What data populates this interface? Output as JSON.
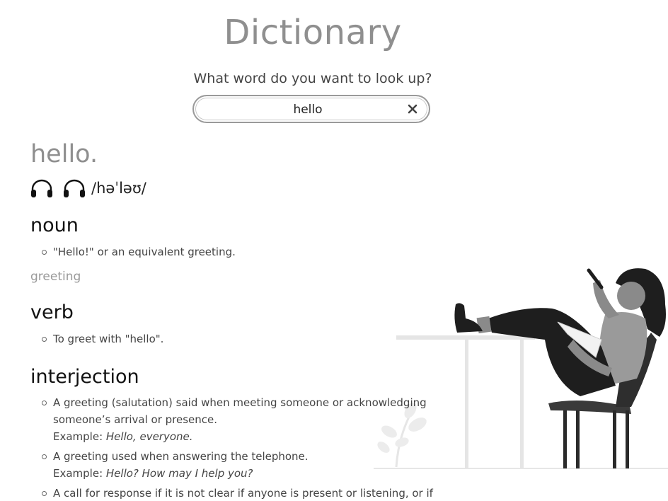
{
  "app": {
    "title": "Dictionary",
    "prompt": "What word do you want to look up?"
  },
  "search": {
    "value": "hello",
    "clear_icon": "close-icon"
  },
  "entry": {
    "word": "hello.",
    "phonetic": "/həˈləʊ/",
    "audio_icons": [
      "headphones-icon",
      "headphones-icon"
    ],
    "meanings": [
      {
        "part_of_speech": "noun",
        "definitions": [
          {
            "text": "\"Hello!\" or an equivalent greeting."
          }
        ],
        "synonym": "greeting"
      },
      {
        "part_of_speech": "verb",
        "definitions": [
          {
            "text": "To greet with \"hello\"."
          }
        ]
      },
      {
        "part_of_speech": "interjection",
        "definitions": [
          {
            "text": "A greeting (salutation) said when meeting someone or acknowledging someone’s arrival or presence.",
            "example_label": "Example: ",
            "example": "Hello, everyone."
          },
          {
            "text": "A greeting used when answering the telephone.",
            "example_label": "Example: ",
            "example": "Hello? How may I help you?"
          },
          {
            "text": "A call for response if it is not clear if anyone is present or listening, or if a"
          }
        ]
      }
    ]
  }
}
